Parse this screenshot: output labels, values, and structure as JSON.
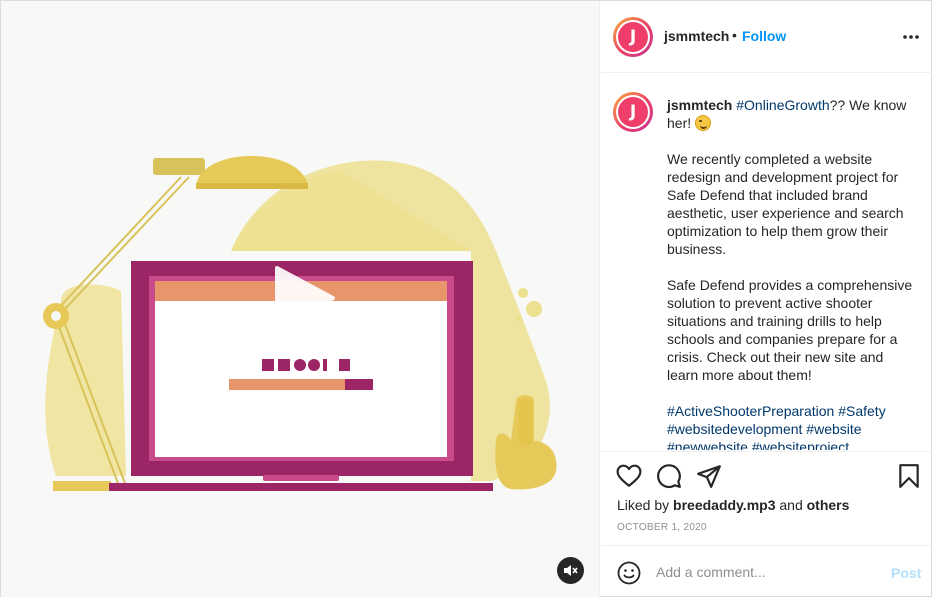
{
  "post": {
    "username": "jsmmtech",
    "avatar_letter": "J",
    "follow_label": "Follow",
    "separator": "•"
  },
  "caption": {
    "username": "jsmmtech",
    "hashtag_intro": "#OnlineGrowth",
    "intro_text": "?? We know her!",
    "paragraph_1": "We recently completed a website redesign and development project for Safe Defend that included brand aesthetic, user experience and search optimization to help them grow their business.",
    "paragraph_2": "Safe Defend provides a comprehensive solution to prevent active shooter situations and training drills to help schools and companies prepare for a crisis. Check out their new site and learn more about them!",
    "hashtags_1": "#ActiveShooterPreparation #Safety",
    "hashtags_2": "#websitedevelopment #website",
    "hashtags_3": "#newwebsite #websiteproject"
  },
  "engagement": {
    "liked_by_prefix": "Liked by",
    "liked_by_user": "breedaddy.mp3",
    "and_text": "and",
    "others_text": "others",
    "date": "OCTOBER 1, 2020"
  },
  "comment_box": {
    "placeholder": "Add a comment...",
    "post_label": "Post"
  },
  "icons": {
    "like": "heart-icon",
    "comment": "comment-icon",
    "share": "paper-plane-icon",
    "save": "bookmark-icon",
    "more": "more-options-icon",
    "play": "play-icon",
    "mute": "speaker-muted-icon",
    "emoji": "smiley-icon"
  },
  "colors": {
    "accent_blue": "#0095f6",
    "illus_yellow": "#e8d37a",
    "illus_magenta": "#9c2565",
    "illus_orange": "#e8956b"
  }
}
